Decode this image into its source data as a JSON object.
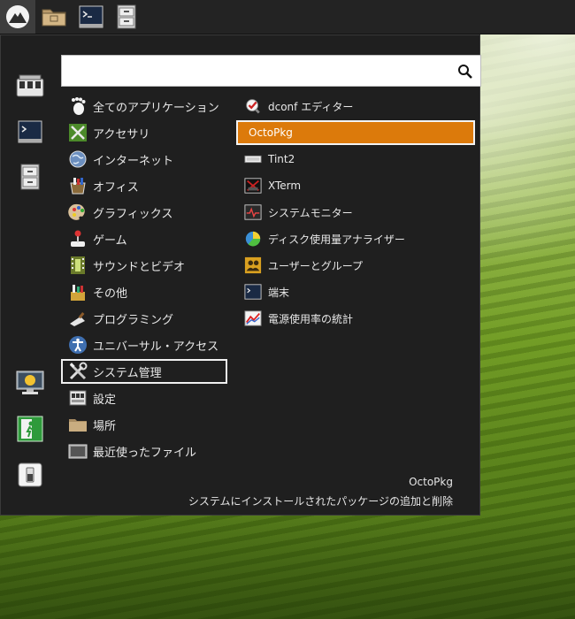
{
  "taskbar": {
    "items": [
      {
        "name": "start-menu-icon"
      },
      {
        "name": "folder-icon"
      },
      {
        "name": "terminal-icon"
      },
      {
        "name": "cabinet-icon"
      }
    ]
  },
  "search": {
    "value": "",
    "placeholder": ""
  },
  "sidebar": {
    "items": [
      {
        "name": "settings-tools-icon"
      },
      {
        "name": "terminal-icon"
      },
      {
        "name": "file-manager-icon"
      },
      {
        "name": "lock-screen-icon"
      },
      {
        "name": "logout-icon"
      },
      {
        "name": "power-icon"
      }
    ]
  },
  "categories": [
    {
      "label": "全てのアプリケーション",
      "icon": "gnome-foot-icon"
    },
    {
      "label": "アクセサリ",
      "icon": "accessories-icon"
    },
    {
      "label": "インターネット",
      "icon": "globe-icon"
    },
    {
      "label": "オフィス",
      "icon": "office-icon"
    },
    {
      "label": "グラフィックス",
      "icon": "palette-icon"
    },
    {
      "label": "ゲーム",
      "icon": "joystick-icon"
    },
    {
      "label": "サウンドとビデオ",
      "icon": "film-icon"
    },
    {
      "label": "その他",
      "icon": "misc-icon"
    },
    {
      "label": "プログラミング",
      "icon": "trowel-icon"
    },
    {
      "label": "ユニバーサル・アクセス",
      "icon": "accessibility-icon"
    },
    {
      "label": "システム管理",
      "icon": "tools-icon"
    },
    {
      "label": "設定",
      "icon": "control-panel-icon"
    },
    {
      "label": "場所",
      "icon": "folder-icon"
    },
    {
      "label": "最近使ったファイル",
      "icon": "recent-files-icon"
    }
  ],
  "selected_category_index": 10,
  "apps": [
    {
      "label": "dconf エディター",
      "icon": "dconf-icon"
    },
    {
      "label": "OctoPkg",
      "icon": "package-icon"
    },
    {
      "label": "Tint2",
      "icon": "panel-icon"
    },
    {
      "label": "XTerm",
      "icon": "xterm-icon"
    },
    {
      "label": "システムモニター",
      "icon": "system-monitor-icon"
    },
    {
      "label": "ディスク使用量アナライザー",
      "icon": "disk-usage-icon"
    },
    {
      "label": "ユーザーとグループ",
      "icon": "users-icon"
    },
    {
      "label": "端末",
      "icon": "terminal-icon"
    },
    {
      "label": "電源使用率の統計",
      "icon": "power-stats-icon"
    }
  ],
  "highlighted_app_index": 1,
  "description": {
    "title": "OctoPkg",
    "text": "システムにインストールされたパッケージの追加と削除"
  },
  "colors": {
    "highlight": "#dc7a0b",
    "menu_bg": "#1f1f1f",
    "panel_bg": "#232323"
  }
}
